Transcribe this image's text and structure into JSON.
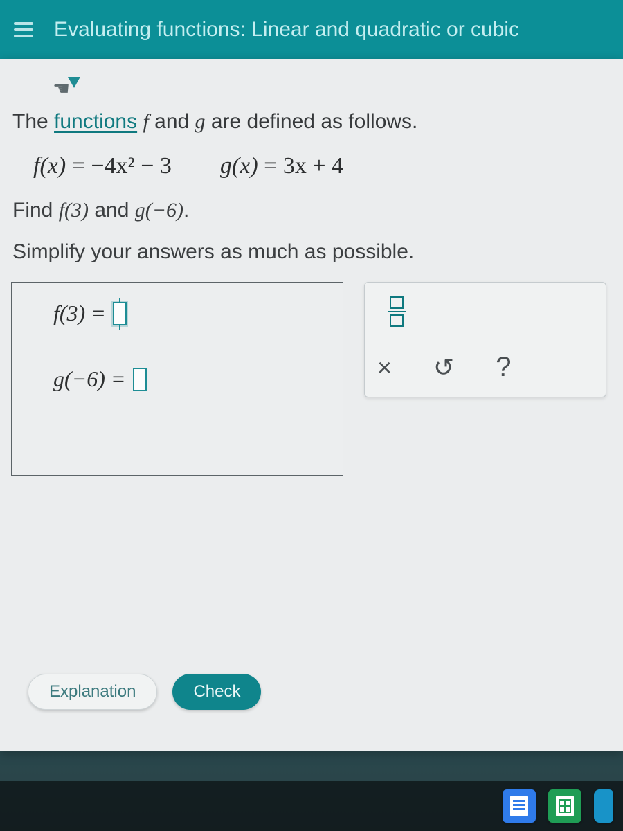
{
  "header": {
    "title": "Evaluating functions: Linear and quadratic or cubic"
  },
  "intro": {
    "prefix": "The ",
    "link": "functions",
    "mid1": " ",
    "f": "f",
    "mid2": " and ",
    "g": "g",
    "suffix": " are defined as follows."
  },
  "defs": {
    "f_lhs": "f(x)",
    "f_rhs": " = −4x² − 3",
    "g_lhs": "g(x)",
    "g_rhs": " = 3x + 4"
  },
  "find": {
    "prefix": "Find ",
    "f3": "f(3)",
    "mid": " and ",
    "gneg6": "g(−6)",
    "suffix": "."
  },
  "simplify": "Simplify your answers as much as possible.",
  "answers": {
    "f_label": "f(3) = ",
    "g_label": "g(−6) = "
  },
  "tools": {
    "fraction": "fraction",
    "clear": "×",
    "reset": "↺",
    "help": "?"
  },
  "actions": {
    "explanation": "Explanation",
    "check": "Check"
  },
  "taskbar": {
    "docs": "Docs",
    "sheets": "Sheets"
  }
}
